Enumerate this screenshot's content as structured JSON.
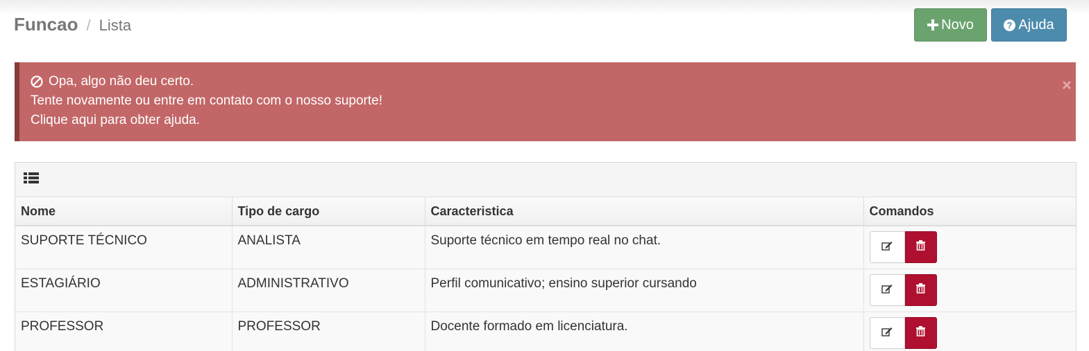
{
  "breadcrumb": {
    "title": "Funcao",
    "separator": "/",
    "current": "Lista"
  },
  "toolbar": {
    "new_label": "Novo",
    "help_label": "Ajuda"
  },
  "alert": {
    "line1": "Opa, algo não deu certo.",
    "line2": "Tente novamente ou entre em contato com o nosso suporte!",
    "line3": "Clique aqui para obter ajuda.",
    "close": "×"
  },
  "table": {
    "headers": [
      "Nome",
      "Tipo de cargo",
      "Caracteristica",
      "Comandos"
    ],
    "rows": [
      [
        "SUPORTE TÉCNICO",
        "ANALISTA",
        "Suporte técnico em tempo real no chat."
      ],
      [
        "ESTAGIÁRIO",
        "ADMINISTRATIVO",
        "Perfil comunicativo; ensino superior cursando"
      ],
      [
        "PROFESSOR",
        "PROFESSOR",
        "Docente formado em licenciatura."
      ]
    ]
  },
  "colors": {
    "alert_bg": "#c26667",
    "new_button": "#6aa36e",
    "help_button": "#4d8bac",
    "delete_button": "#b0102f"
  },
  "icons": {
    "new": "plus-icon",
    "help": "question-circle-icon",
    "alert": "ban-icon",
    "panel": "list-icon",
    "edit": "edit-icon",
    "delete": "trash-icon"
  }
}
